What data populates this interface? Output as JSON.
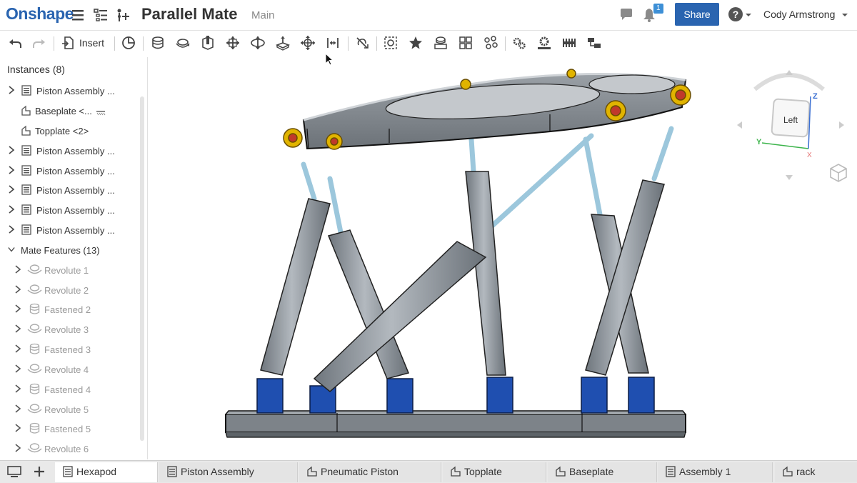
{
  "header": {
    "logo": "Onshape",
    "document_title": "Parallel Mate",
    "branch": "Main",
    "share_label": "Share",
    "notification_count": "1",
    "user_name": "Cody Armstrong"
  },
  "toolbar": {
    "insert_label": "Insert"
  },
  "instances": {
    "title": "Instances (8)",
    "items": [
      {
        "label": "Piston Assembly ...",
        "type": "assembly",
        "expandable": true
      },
      {
        "label": "Baseplate <...",
        "type": "part",
        "expandable": false
      },
      {
        "label": "Topplate <2>",
        "type": "part",
        "expandable": false
      },
      {
        "label": "Piston Assembly ...",
        "type": "assembly",
        "expandable": true
      },
      {
        "label": "Piston Assembly ...",
        "type": "assembly",
        "expandable": true
      },
      {
        "label": "Piston Assembly ...",
        "type": "assembly",
        "expandable": true
      },
      {
        "label": "Piston Assembly ...",
        "type": "assembly",
        "expandable": true
      },
      {
        "label": "Piston Assembly ...",
        "type": "assembly",
        "expandable": true
      }
    ]
  },
  "mate_features": {
    "title": "Mate Features (13)",
    "items": [
      {
        "label": "Revolute 1",
        "type": "revolute"
      },
      {
        "label": "Revolute 2",
        "type": "revolute"
      },
      {
        "label": "Fastened 2",
        "type": "fastened"
      },
      {
        "label": "Revolute 3",
        "type": "revolute"
      },
      {
        "label": "Fastened 3",
        "type": "fastened"
      },
      {
        "label": "Revolute 4",
        "type": "revolute"
      },
      {
        "label": "Fastened 4",
        "type": "fastened"
      },
      {
        "label": "Revolute 5",
        "type": "revolute"
      },
      {
        "label": "Fastened 5",
        "type": "fastened"
      },
      {
        "label": "Revolute 6",
        "type": "revolute"
      }
    ]
  },
  "view_cube": {
    "face_label": "Left",
    "axis_z": "Z",
    "axis_y": "Y",
    "axis_x": "X"
  },
  "tabs": [
    {
      "label": "Hexapod",
      "type": "assembly",
      "active": true
    },
    {
      "label": "Piston Assembly",
      "type": "assembly",
      "active": false
    },
    {
      "label": "Pneumatic Piston",
      "type": "partstudio",
      "active": false
    },
    {
      "label": "Topplate",
      "type": "partstudio",
      "active": false
    },
    {
      "label": "Baseplate",
      "type": "partstudio",
      "active": false
    },
    {
      "label": "Assembly 1",
      "type": "assembly",
      "active": false
    },
    {
      "label": "rack",
      "type": "partstudio",
      "active": false
    }
  ],
  "colors": {
    "brand": "#2a64b0",
    "steel": "#8d949b",
    "rod": "#9cc7dc",
    "bracket": "#1f4fb0",
    "joint": "#e1b400",
    "ball": "#c0392b"
  }
}
